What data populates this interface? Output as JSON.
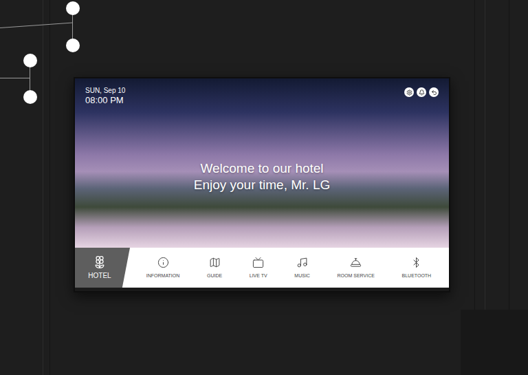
{
  "clock": {
    "date": "SUN, Sep 10",
    "time": "08:00 PM"
  },
  "welcome": {
    "title": "Welcome to our hotel",
    "subtitle": "Enjoy your time, Mr. LG"
  },
  "home": {
    "label": "HOTEL",
    "selected": true
  },
  "menu": [
    {
      "label": "INFORMATION",
      "selected": false
    },
    {
      "label": "GUIDE",
      "selected": false
    },
    {
      "label": "LIVE TV",
      "selected": false
    },
    {
      "label": "MUSIC",
      "selected": false
    },
    {
      "label": "ROOM SERVICE",
      "selected": false
    },
    {
      "label": "BLUETOOTH",
      "selected": false
    }
  ]
}
